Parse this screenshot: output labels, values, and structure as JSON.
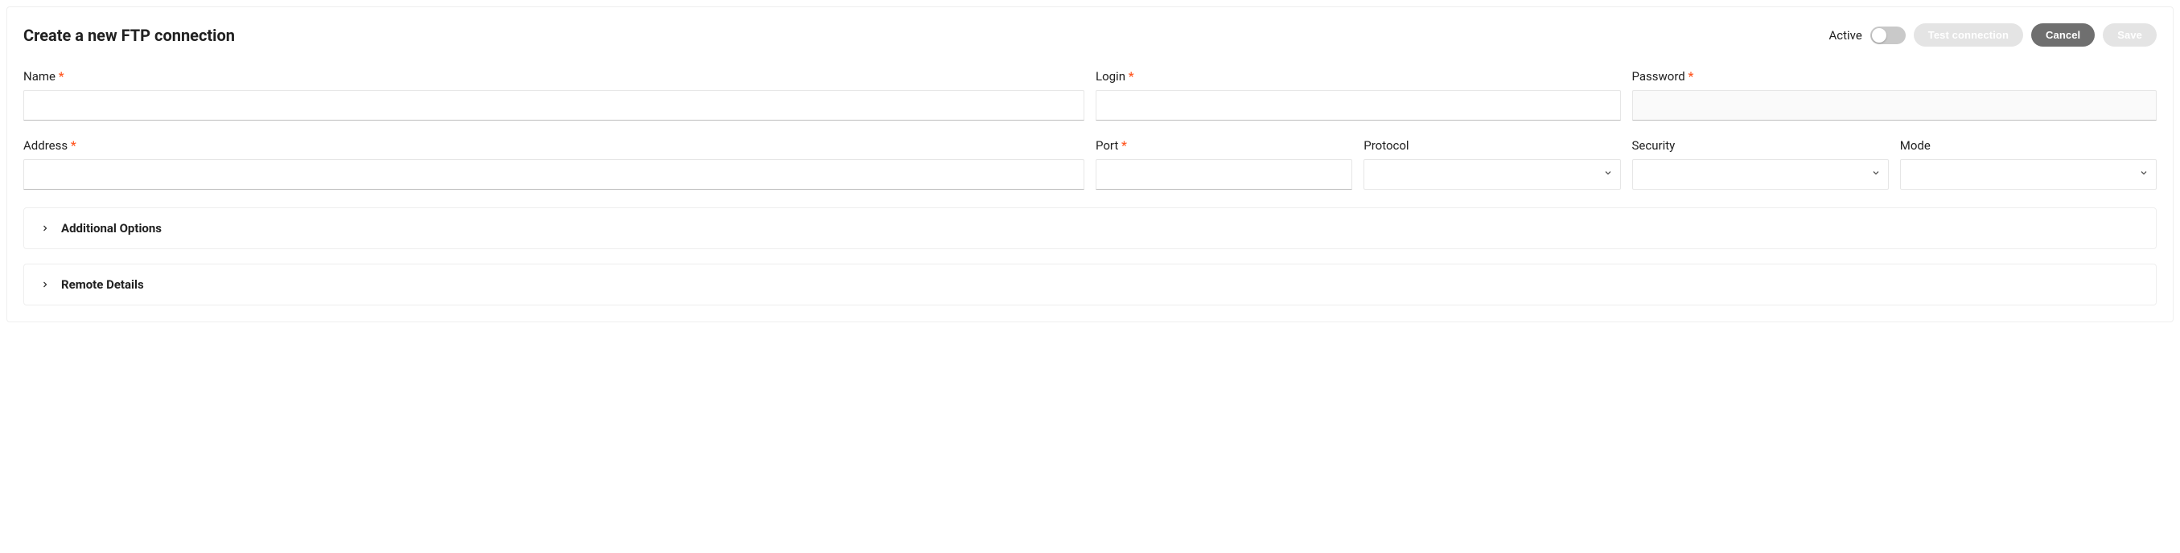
{
  "header": {
    "title": "Create a new FTP connection",
    "active_label": "Active",
    "test_label": "Test connection",
    "cancel_label": "Cancel",
    "save_label": "Save"
  },
  "fields": {
    "name": {
      "label": "Name",
      "required": true,
      "value": ""
    },
    "login": {
      "label": "Login",
      "required": true,
      "value": ""
    },
    "password": {
      "label": "Password",
      "required": true,
      "value": ""
    },
    "address": {
      "label": "Address",
      "required": true,
      "value": ""
    },
    "port": {
      "label": "Port",
      "required": true,
      "value": ""
    },
    "protocol": {
      "label": "Protocol",
      "required": false,
      "value": ""
    },
    "security": {
      "label": "Security",
      "required": false,
      "value": ""
    },
    "mode": {
      "label": "Mode",
      "required": false,
      "value": ""
    }
  },
  "panels": {
    "additional": "Additional Options",
    "remote": "Remote Details"
  },
  "required_marker": "*"
}
